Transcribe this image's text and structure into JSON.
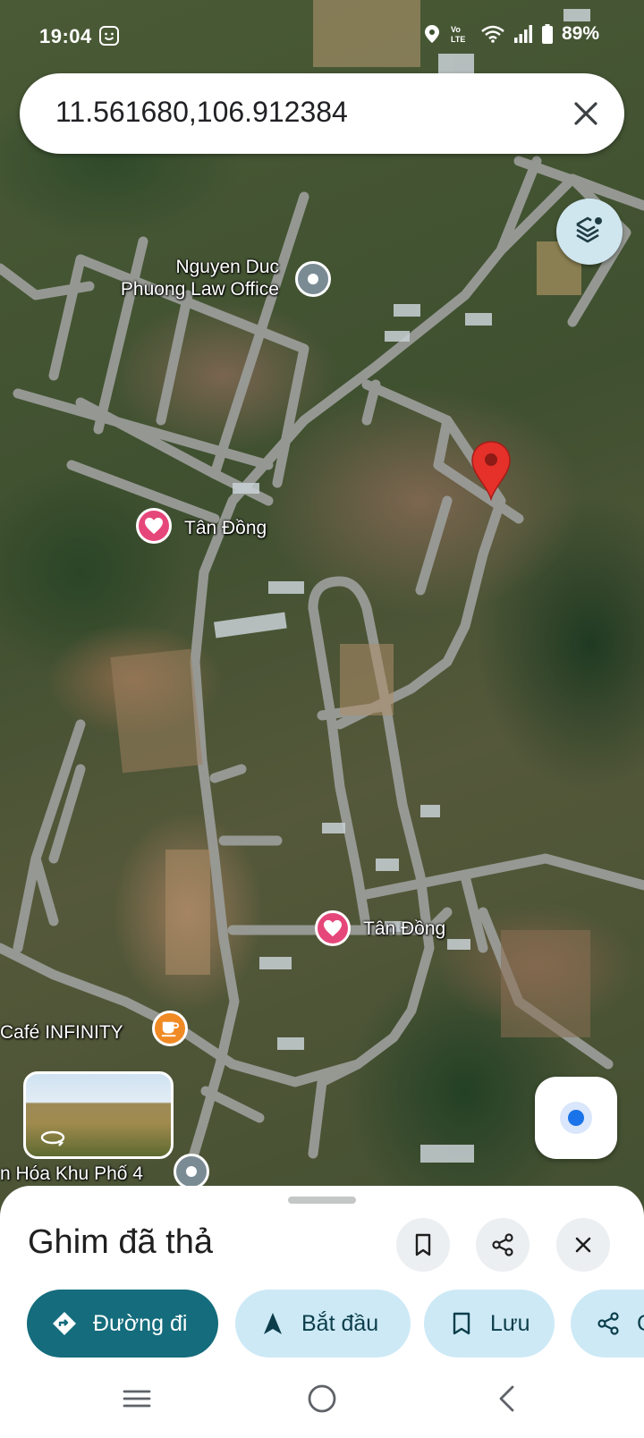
{
  "status_bar": {
    "time": "19:04",
    "battery": "89%",
    "icons": [
      "location-icon",
      "volte-icon",
      "wifi-icon",
      "signal-icon",
      "battery-icon"
    ]
  },
  "search": {
    "value": "11.561680,106.912384",
    "clear_icon": "close-icon"
  },
  "map": {
    "labels": {
      "law_office": "Nguyen Duc\nPhuong Law Office",
      "tan_dong_1": "Tân Đồng",
      "tan_dong_2": "Tân Đồng",
      "cafe": "Café INFINITY",
      "cultural_house": "n Hóa Khu Phố 4"
    },
    "pin_color": "#d93025"
  },
  "sheet": {
    "title": "Ghim đã thả",
    "actions": {
      "directions": "Đường đi",
      "start": "Bắt đầu",
      "save": "Lưu",
      "share": "C"
    }
  },
  "colors": {
    "primary_chip": "#146c7c",
    "secondary_chip": "#cde9f6",
    "location_blue": "#1a73e8"
  }
}
